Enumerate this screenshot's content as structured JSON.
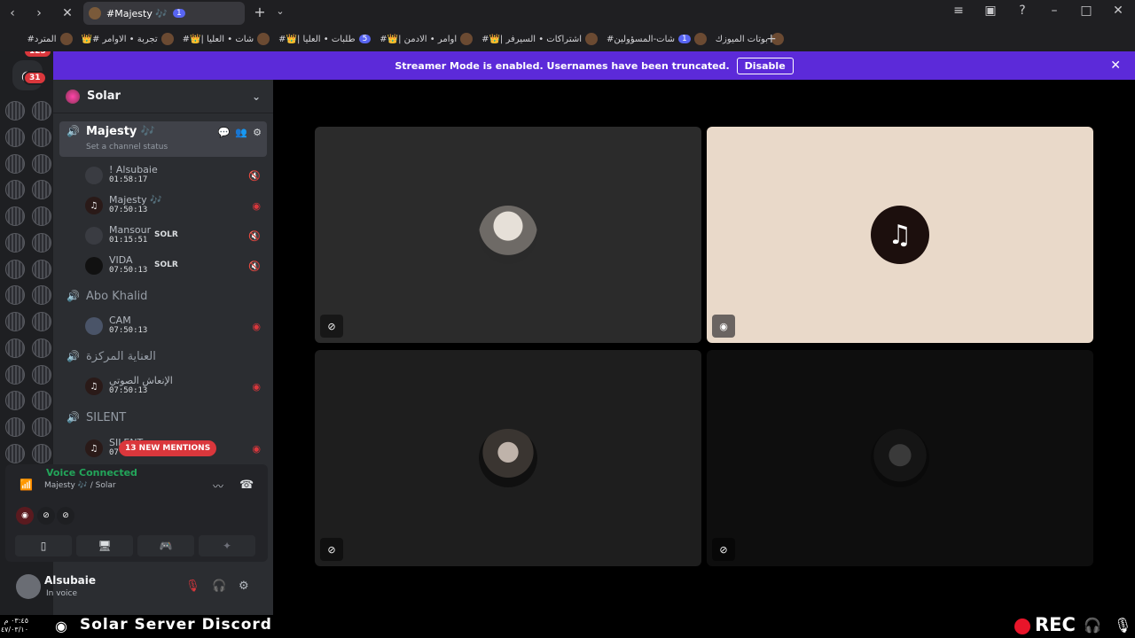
{
  "browser": {
    "tab_title": "#Majesty 🎶",
    "tab_badge": "1",
    "bookmarks": [
      {
        "label": "المترد#"
      },
      {
        "label": "تجربة • الاوامر #👑"
      },
      {
        "label": "شات • العليا |👑#"
      },
      {
        "label": "طلبات • العليا |👑#",
        "badge": "5"
      },
      {
        "label": "اوامر • الادمن |👑#"
      },
      {
        "label": "اشتراكات • السيرفر |👑#"
      },
      {
        "label": "شات-المسؤولين#",
        "badge": "1"
      },
      {
        "label": "بوتات الميوزك"
      }
    ]
  },
  "rail": {
    "home_badge": "125",
    "dm_badge": "31"
  },
  "banner": {
    "text": "Streamer Mode is enabled. Usernames have been truncated.",
    "button": "Disable"
  },
  "server": {
    "name": "Solar"
  },
  "channels": [
    {
      "name": "Majesty 🎶",
      "status": "Set a channel status"
    },
    {
      "name": "Abo Khalid"
    },
    {
      "name": "العناية المركزة"
    },
    {
      "name": "SILENT"
    }
  ],
  "members": [
    {
      "name": "! Alsubaie",
      "time": "01:58:17"
    },
    {
      "name": "Majesty 🎶",
      "time": "07:50:13"
    },
    {
      "name": "Mansour",
      "time": "01:15:51",
      "tag": "SOLR"
    },
    {
      "name": "VIDA",
      "time": "07:50:13",
      "tag": "SOLR"
    },
    {
      "name": "CAM",
      "time": "07:50:13"
    },
    {
      "name": "الإنعاش الصوتي",
      "time": "07:50:13"
    },
    {
      "name": "SILENT",
      "time": "07"
    }
  ],
  "mentions": "13 NEW MENTIONS",
  "voice": {
    "status": "Voice Connected",
    "channel": "Majesty 🎶 / Solar"
  },
  "user": {
    "name": "Alsubaie",
    "status": "In voice"
  },
  "taskbar": {
    "time": "٠٣:٤٥ م",
    "date": "٤٧/٠٣/١٠",
    "brand": "Solar Server Discord",
    "rec": "REC"
  },
  "colors": {
    "accent": "#5c2ad9",
    "danger": "#da373c",
    "online": "#23a55a"
  }
}
